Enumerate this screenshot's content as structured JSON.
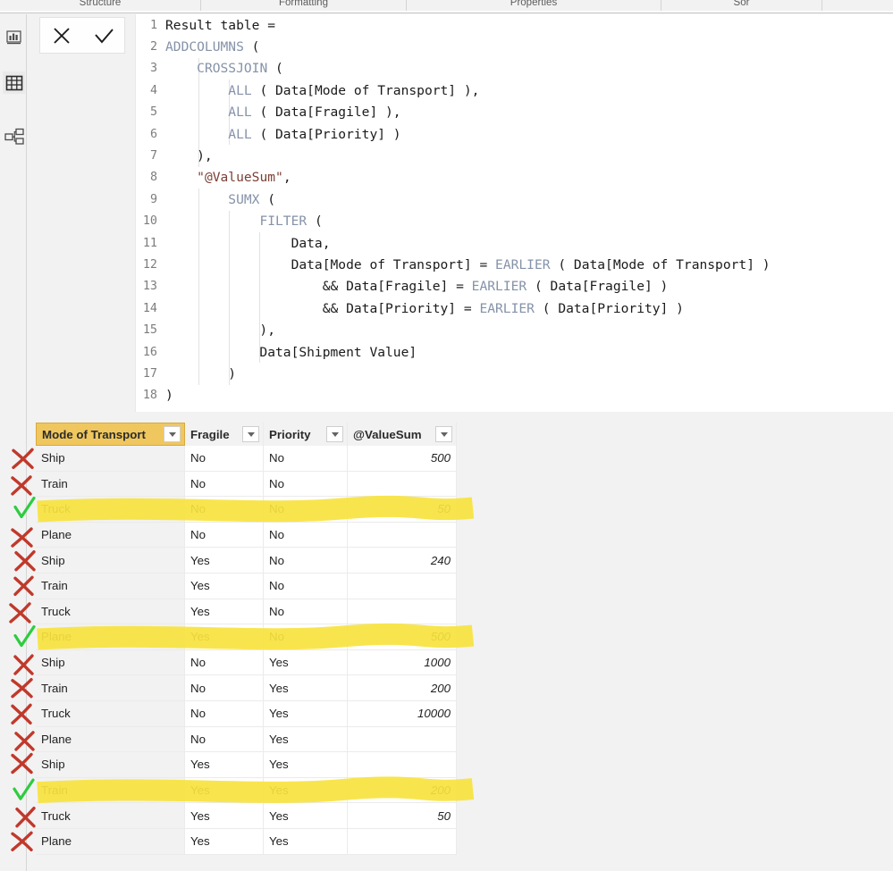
{
  "app": {
    "ribbon_groups": [
      "Structure",
      "Formatting",
      "Properties",
      "Sor",
      ""
    ],
    "rail_items": [
      {
        "name": "report-view",
        "label": "Report view"
      },
      {
        "name": "data-view",
        "label": "Data view"
      },
      {
        "name": "model-view",
        "label": "Model view"
      }
    ]
  },
  "formula_bar": {
    "cancel_label": "✕",
    "commit_label": "✓"
  },
  "code": {
    "lines": [
      {
        "n": "1",
        "parts": [
          {
            "t": "Result table =",
            "c": "plain"
          }
        ]
      },
      {
        "n": "2",
        "parts": [
          {
            "t": "ADDCOLUMNS",
            "c": "fn"
          },
          {
            "t": " (",
            "c": "plain"
          }
        ]
      },
      {
        "n": "3",
        "parts": [
          {
            "t": "    ",
            "c": "plain"
          },
          {
            "t": "CROSSJOIN",
            "c": "fn"
          },
          {
            "t": " (",
            "c": "plain"
          }
        ]
      },
      {
        "n": "4",
        "parts": [
          {
            "t": "        ",
            "c": "plain"
          },
          {
            "t": "ALL",
            "c": "fn"
          },
          {
            "t": " ( Data[Mode of Transport] ),",
            "c": "plain"
          }
        ]
      },
      {
        "n": "5",
        "parts": [
          {
            "t": "        ",
            "c": "plain"
          },
          {
            "t": "ALL",
            "c": "fn"
          },
          {
            "t": " ( Data[Fragile] ),",
            "c": "plain"
          }
        ]
      },
      {
        "n": "6",
        "parts": [
          {
            "t": "        ",
            "c": "plain"
          },
          {
            "t": "ALL",
            "c": "fn"
          },
          {
            "t": " ( Data[Priority] )",
            "c": "plain"
          }
        ]
      },
      {
        "n": "7",
        "parts": [
          {
            "t": "    ),",
            "c": "plain"
          }
        ]
      },
      {
        "n": "8",
        "parts": [
          {
            "t": "    ",
            "c": "plain"
          },
          {
            "t": "\"@ValueSum\"",
            "c": "str"
          },
          {
            "t": ",",
            "c": "plain"
          }
        ]
      },
      {
        "n": "9",
        "parts": [
          {
            "t": "        ",
            "c": "plain"
          },
          {
            "t": "SUMX",
            "c": "fn"
          },
          {
            "t": " (",
            "c": "plain"
          }
        ]
      },
      {
        "n": "10",
        "parts": [
          {
            "t": "            ",
            "c": "plain"
          },
          {
            "t": "FILTER",
            "c": "fn"
          },
          {
            "t": " (",
            "c": "plain"
          }
        ]
      },
      {
        "n": "11",
        "parts": [
          {
            "t": "                Data,",
            "c": "plain"
          }
        ]
      },
      {
        "n": "12",
        "parts": [
          {
            "t": "                Data[Mode of Transport] = ",
            "c": "plain"
          },
          {
            "t": "EARLIER",
            "c": "fn"
          },
          {
            "t": " ( Data[Mode of Transport] )",
            "c": "plain"
          }
        ]
      },
      {
        "n": "13",
        "parts": [
          {
            "t": "                    && Data[Fragile] = ",
            "c": "plain"
          },
          {
            "t": "EARLIER",
            "c": "fn"
          },
          {
            "t": " ( Data[Fragile] )",
            "c": "plain"
          }
        ]
      },
      {
        "n": "14",
        "parts": [
          {
            "t": "                    && Data[Priority] = ",
            "c": "plain"
          },
          {
            "t": "EARLIER",
            "c": "fn"
          },
          {
            "t": " ( Data[Priority] )",
            "c": "plain"
          }
        ]
      },
      {
        "n": "15",
        "parts": [
          {
            "t": "            ),",
            "c": "plain"
          }
        ]
      },
      {
        "n": "16",
        "parts": [
          {
            "t": "            Data[Shipment Value]",
            "c": "plain"
          }
        ]
      },
      {
        "n": "17",
        "parts": [
          {
            "t": "        )",
            "c": "plain"
          }
        ]
      },
      {
        "n": "18",
        "parts": [
          {
            "t": ")",
            "c": "plain"
          }
        ]
      }
    ]
  },
  "grid": {
    "columns": [
      {
        "label": "Mode of Transport",
        "active": true
      },
      {
        "label": "Fragile",
        "active": false
      },
      {
        "label": "Priority",
        "active": false
      },
      {
        "label": "@ValueSum",
        "active": false
      }
    ],
    "rows": [
      {
        "mode": "Ship",
        "fragile": "No",
        "priority": "No",
        "value": "500",
        "mark": "x",
        "highlight": false
      },
      {
        "mode": "Train",
        "fragile": "No",
        "priority": "No",
        "value": "",
        "mark": "x",
        "highlight": false
      },
      {
        "mode": "Truck",
        "fragile": "No",
        "priority": "No",
        "value": "50",
        "mark": "check",
        "highlight": true
      },
      {
        "mode": "Plane",
        "fragile": "No",
        "priority": "No",
        "value": "",
        "mark": "x",
        "highlight": false
      },
      {
        "mode": "Ship",
        "fragile": "Yes",
        "priority": "No",
        "value": "240",
        "mark": "x",
        "highlight": false
      },
      {
        "mode": "Train",
        "fragile": "Yes",
        "priority": "No",
        "value": "",
        "mark": "x",
        "highlight": false
      },
      {
        "mode": "Truck",
        "fragile": "Yes",
        "priority": "No",
        "value": "",
        "mark": "x",
        "highlight": false
      },
      {
        "mode": "Plane",
        "fragile": "Yes",
        "priority": "No",
        "value": "500",
        "mark": "check",
        "highlight": true
      },
      {
        "mode": "Ship",
        "fragile": "No",
        "priority": "Yes",
        "value": "1000",
        "mark": "x",
        "highlight": false
      },
      {
        "mode": "Train",
        "fragile": "No",
        "priority": "Yes",
        "value": "200",
        "mark": "x",
        "highlight": false
      },
      {
        "mode": "Truck",
        "fragile": "No",
        "priority": "Yes",
        "value": "10000",
        "mark": "x",
        "highlight": false
      },
      {
        "mode": "Plane",
        "fragile": "No",
        "priority": "Yes",
        "value": "",
        "mark": "x",
        "highlight": false
      },
      {
        "mode": "Ship",
        "fragile": "Yes",
        "priority": "Yes",
        "value": "",
        "mark": "x",
        "highlight": false
      },
      {
        "mode": "Train",
        "fragile": "Yes",
        "priority": "Yes",
        "value": "200",
        "mark": "check",
        "highlight": true
      },
      {
        "mode": "Truck",
        "fragile": "Yes",
        "priority": "Yes",
        "value": "50",
        "mark": "x",
        "highlight": false
      },
      {
        "mode": "Plane",
        "fragile": "Yes",
        "priority": "Yes",
        "value": "",
        "mark": "x",
        "highlight": false
      }
    ]
  },
  "colors": {
    "accent_gold": "#efc75e",
    "highlighter_yellow": "#f7e33f",
    "annotation_red": "#c0392b",
    "annotation_green": "#2ecc40",
    "fn_blue": "#8592a8",
    "string_maroon": "#7b3f35"
  }
}
